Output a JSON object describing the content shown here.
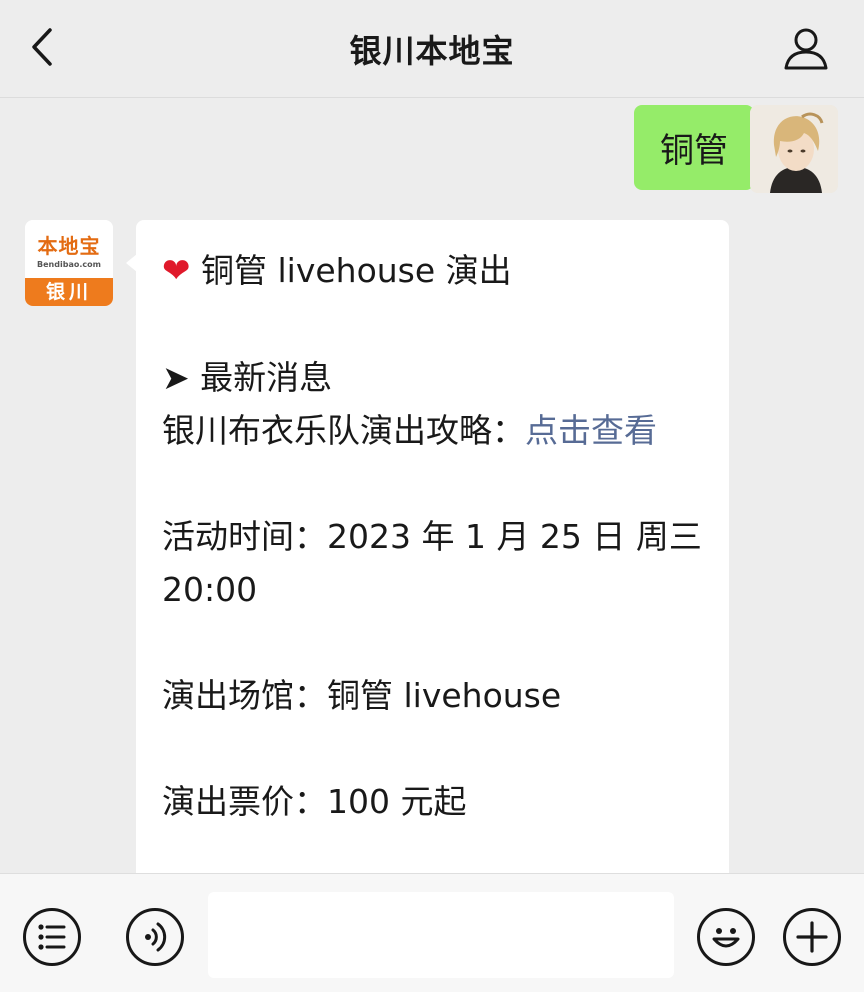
{
  "header": {
    "title": "银川本地宝",
    "back_icon": "chevron-left-icon",
    "profile_icon": "user-icon"
  },
  "messages": {
    "outgoing": {
      "text": "铜管"
    },
    "incoming": {
      "logo_main": "本地宝",
      "logo_sub": "Bendibao.com",
      "logo_city": "银川",
      "heading": "铜管 livehouse 演出",
      "news_label": "➤ 最新消息",
      "guide_text": "银川布衣乐队演出攻略：",
      "guide_link": "点击查看",
      "time_line1": "活动时间：2023 年 1 月 25 日 周三",
      "time_line2": "20:00",
      "venue": "演出场馆：铜管 livehouse",
      "price": "演出票价：100 元起"
    }
  },
  "inputbar": {
    "menu_icon": "list-icon",
    "voice_icon": "voice-icon",
    "emoji_icon": "emoji-icon",
    "plus_icon": "plus-icon",
    "input_value": ""
  },
  "colors": {
    "background": "#ededed",
    "outgoing_bubble": "#95ec69",
    "link": "#576b95",
    "logo_orange": "#ee7b1d"
  }
}
